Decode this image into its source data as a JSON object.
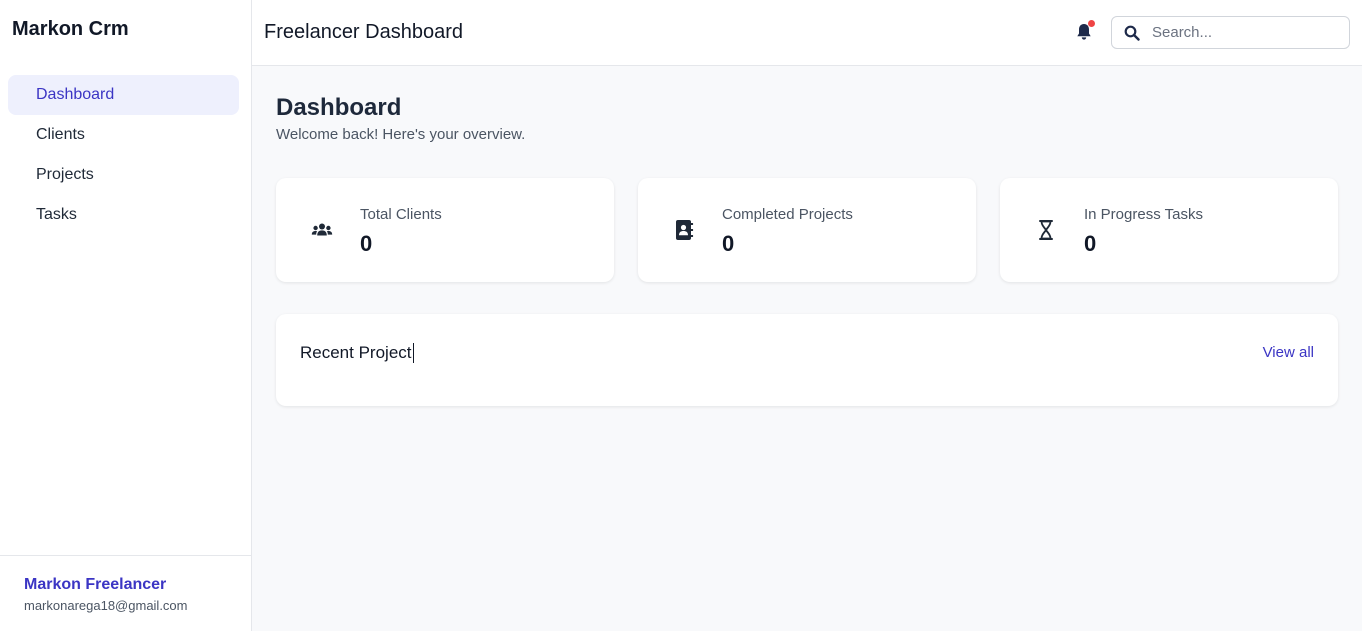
{
  "brand": "Markon Crm",
  "sidebar": {
    "items": [
      {
        "label": "Dashboard",
        "active": true
      },
      {
        "label": "Clients",
        "active": false
      },
      {
        "label": "Projects",
        "active": false
      },
      {
        "label": "Tasks",
        "active": false
      }
    ],
    "user": {
      "name": "Markon Freelancer",
      "email": "markonarega18@gmail.com"
    }
  },
  "header": {
    "title": "Freelancer Dashboard",
    "notification_icon": "bell-icon",
    "search": {
      "placeholder": "Search...",
      "value": ""
    }
  },
  "main": {
    "title": "Dashboard",
    "subtitle": "Welcome back! Here's your overview.",
    "stats": [
      {
        "label": "Total Clients",
        "value": "0",
        "icon": "users-icon"
      },
      {
        "label": "Completed Projects",
        "value": "0",
        "icon": "address-book-icon"
      },
      {
        "label": "In Progress Tasks",
        "value": "0",
        "icon": "hourglass-icon"
      }
    ],
    "recent": {
      "title": "Recent Project",
      "link": "View all"
    }
  },
  "colors": {
    "accent": "#3b35c4",
    "active_bg": "#eef0fd",
    "notification_dot": "#ef4444",
    "page_bg": "#f8f9fb"
  }
}
